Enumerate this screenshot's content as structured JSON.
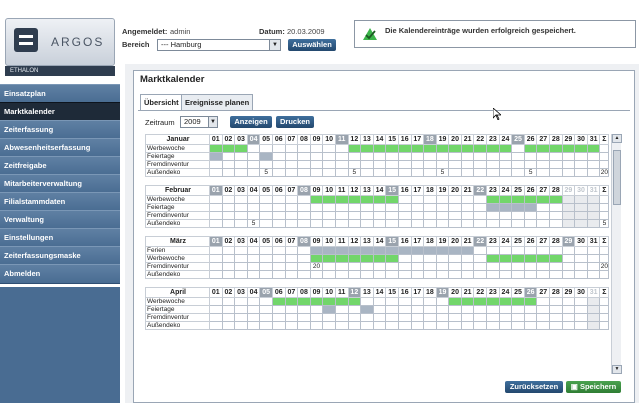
{
  "logo": {
    "word": "ARGOS",
    "sub": "ETHALON"
  },
  "header": {
    "login_label": "Angemeldet:",
    "login_user": "admin",
    "date_label": "Datum:",
    "date_value": "20.03.2009",
    "bereich_label": "Bereich",
    "bereich_value": "--- Hamburg",
    "select_button": "Auswählen"
  },
  "notice": {
    "text": "Die Kalendereinträge wurden erfolgreich gespeichert."
  },
  "sidebar": {
    "items": [
      {
        "label": "Einsatzplan"
      },
      {
        "label": "Marktkalender",
        "active": true
      },
      {
        "label": "Zeiterfassung"
      },
      {
        "label": "Abwesenheitserfassung"
      },
      {
        "label": "Zeitfreigabe"
      },
      {
        "label": "Mitarbeiterverwaltung"
      },
      {
        "label": "Filialstammdaten"
      },
      {
        "label": "Verwaltung"
      },
      {
        "label": "Einstellungen"
      },
      {
        "label": "Zeiterfassungsmaske"
      },
      {
        "label": "Abmelden"
      }
    ]
  },
  "page": {
    "title": "Marktkalender",
    "tabs": [
      {
        "label": "Übersicht",
        "active": true
      },
      {
        "label": "Ereignisse planen"
      }
    ],
    "zeitraum_label": "Zeitraum",
    "year": "2009",
    "show_button": "Anzeigen",
    "print_button": "Drucken",
    "reset_button": "Zurücksetzen",
    "save_button": "Speichern"
  },
  "colors": {
    "accent": "#2f5a86",
    "event": "#72d66a",
    "weekend": "#9aa3ad",
    "partial": "#a9b5c3",
    "success": "#3bb54a"
  },
  "calendar": {
    "sum_label": "Σ",
    "months": [
      {
        "name": "Januar",
        "days": 31,
        "weekends": [
          4,
          11,
          18,
          25
        ],
        "rows": [
          {
            "label": "Werbewoche",
            "green": [
              1,
              2,
              3
            ],
            "gray": [],
            "total": "",
            "green2": [
              12,
              13,
              14,
              15,
              16,
              17,
              18,
              19,
              20,
              21,
              22,
              23,
              24,
              26,
              27,
              28,
              29,
              30,
              31
            ]
          },
          {
            "label": "Feiertage",
            "green": [],
            "gray": [
              1,
              5
            ],
            "total": ""
          },
          {
            "label": "Fremdinventur",
            "green": [],
            "gray": [],
            "total": ""
          },
          {
            "label": "Außendeko",
            "green": [],
            "gray": [],
            "marks": {
              "5": "5",
              "12": "5",
              "19": "5",
              "26": "5"
            },
            "total": "20"
          }
        ]
      },
      {
        "name": "Februar",
        "days": 28,
        "weekends": [
          1,
          8,
          15,
          22
        ],
        "rows": [
          {
            "label": "Werbewoche",
            "green": [
              9,
              10,
              11,
              12,
              13,
              14,
              15,
              23,
              24,
              25,
              26,
              27,
              28
            ],
            "gray": [],
            "total": ""
          },
          {
            "label": "Feiertage",
            "green": [],
            "gray": [
              23,
              24,
              25,
              26
            ],
            "total": ""
          },
          {
            "label": "Fremdinventur",
            "green": [],
            "gray": [],
            "total": ""
          },
          {
            "label": "Außendeko",
            "green": [],
            "gray": [],
            "marks": {
              "4": "5"
            },
            "total": "5"
          }
        ]
      },
      {
        "name": "März",
        "days": 31,
        "weekends": [
          1,
          8,
          15,
          22,
          29
        ],
        "rows": [
          {
            "label": "Ferien",
            "green": [],
            "gray": [
              9,
              10,
              11,
              12,
              13,
              14,
              15,
              16,
              17,
              18,
              19,
              20,
              21
            ],
            "total": ""
          },
          {
            "label": "Werbewoche",
            "green": [
              9,
              10,
              11,
              12,
              13,
              14,
              15,
              23,
              24,
              25,
              26,
              27,
              28
            ],
            "gray": [],
            "total": ""
          },
          {
            "label": "Fremdinventur",
            "green": [],
            "gray": [],
            "marks": {
              "9": "20"
            },
            "total": "20"
          },
          {
            "label": "Außendeko",
            "green": [],
            "gray": [],
            "total": ""
          }
        ]
      },
      {
        "name": "April",
        "days": 30,
        "weekends": [
          5,
          12,
          19,
          26
        ],
        "rows": [
          {
            "label": "Werbewoche",
            "green": [
              6,
              7,
              8,
              9,
              10,
              11,
              12,
              20,
              21,
              22,
              23,
              24,
              25,
              26
            ],
            "gray": [],
            "total": ""
          },
          {
            "label": "Feiertage",
            "green": [],
            "gray": [
              10,
              13
            ],
            "total": ""
          },
          {
            "label": "Fremdinventur",
            "green": [],
            "gray": [],
            "total": ""
          },
          {
            "label": "Außendeko",
            "green": [],
            "gray": [],
            "total": ""
          }
        ]
      }
    ]
  }
}
